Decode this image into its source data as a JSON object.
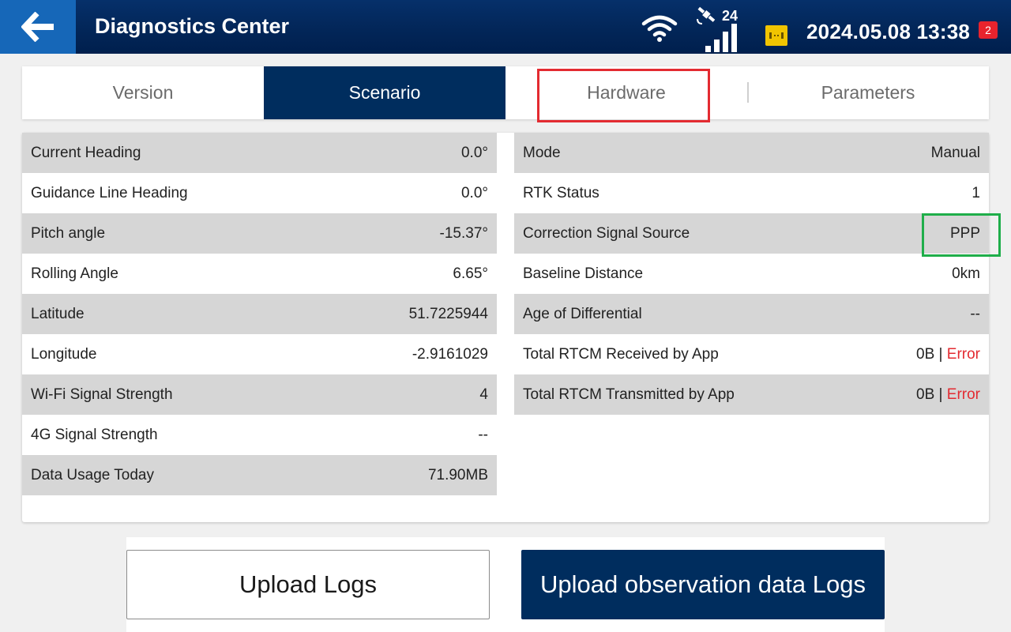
{
  "header": {
    "title": "Diagnostics Center",
    "satellite_count": "24",
    "datetime": "2024.05.08 13:38",
    "notification_count": "2",
    "icons": [
      "back-arrow-icon",
      "wifi-icon",
      "satellite-icon",
      "signal-bars-icon",
      "device-icon"
    ]
  },
  "tabs": [
    {
      "label": "Version",
      "active": false
    },
    {
      "label": "Scenario",
      "active": true
    },
    {
      "label": "Hardware",
      "active": false
    },
    {
      "label": "Parameters",
      "active": false
    }
  ],
  "left_rows": [
    {
      "label": "Current Heading",
      "value": "0.0°"
    },
    {
      "label": "Guidance Line Heading",
      "value": "0.0°"
    },
    {
      "label": "Pitch angle",
      "value": "-15.37°"
    },
    {
      "label": "Rolling Angle",
      "value": "6.65°"
    },
    {
      "label": "Latitude",
      "value": "51.7225944"
    },
    {
      "label": "Longitude",
      "value": "-2.9161029"
    },
    {
      "label": "Wi-Fi Signal Strength",
      "value": "4"
    },
    {
      "label": "4G Signal Strength",
      "value": "--"
    },
    {
      "label": "Data Usage Today",
      "value": "71.90MB"
    }
  ],
  "right_rows": [
    {
      "label": "Mode",
      "value": "Manual"
    },
    {
      "label": "RTK Status",
      "value": "1"
    },
    {
      "label": "Correction Signal Source",
      "value": "PPP"
    },
    {
      "label": "Baseline Distance",
      "value": "0km"
    },
    {
      "label": "Age of Differential",
      "value": "--"
    },
    {
      "label": "Total RTCM Received by App",
      "value": "0B",
      "sep": "|",
      "status": "Error"
    },
    {
      "label": "Total RTCM Transmitted by App",
      "value": "0B",
      "sep": "|",
      "status": "Error"
    }
  ],
  "buttons": {
    "upload_logs": "Upload Logs",
    "upload_obs": "Upload observation data Logs"
  },
  "colors": {
    "header_bg": "#03275a",
    "accent": "#002d5e",
    "back_button": "#1667b8",
    "error": "#e32b31",
    "highlight_red": "#e32b31",
    "highlight_green": "#1fae4a"
  }
}
